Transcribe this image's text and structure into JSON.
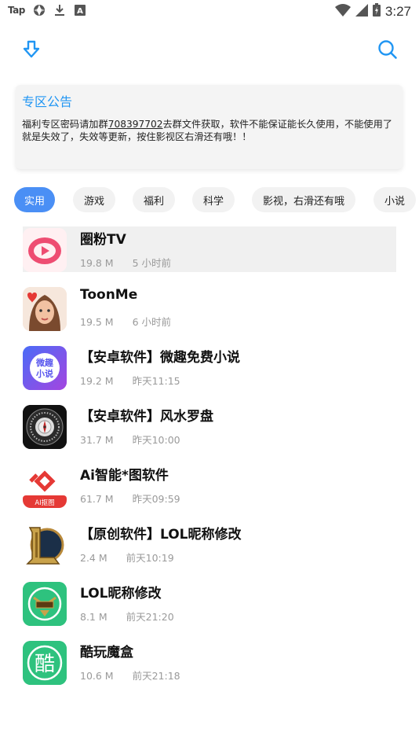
{
  "status_bar": {
    "left_text": "Tap",
    "time": "3:27",
    "icons": [
      "aperture-icon",
      "download-icon",
      "keyboard-icon",
      "wifi-icon",
      "signal-icon",
      "battery-icon"
    ]
  },
  "toolbar": {
    "download_icon": "download-arrow-icon",
    "search_icon": "search-icon",
    "accent_color": "#2196f3"
  },
  "notice": {
    "title": "专区公告",
    "body_prefix": "福利专区密码请加群",
    "qq_group": "708397702",
    "body_suffix": "去群文件获取，软件不能保证能长久使用，不能使用了就是失效了，失效等更新，按住影视区右滑还有哦！！"
  },
  "tabs": [
    {
      "label": "实用",
      "active": true
    },
    {
      "label": "游戏",
      "active": false
    },
    {
      "label": "福利",
      "active": false
    },
    {
      "label": "科学",
      "active": false
    },
    {
      "label": "影视，右滑还有哦",
      "active": false
    },
    {
      "label": "小说",
      "active": false
    }
  ],
  "apps": [
    {
      "name": "圈粉TV",
      "size": "19.8 M",
      "time": "5 小时前",
      "icon": "quanfen-tv-icon"
    },
    {
      "name": "ToonMe",
      "size": "19.5 M",
      "time": "6 小时前",
      "icon": "toonme-icon"
    },
    {
      "name": "【安卓软件】微趣免费小说",
      "size": "19.2 M",
      "time": "昨天11:15",
      "icon": "weiqu-novel-icon",
      "icon_text": "微趣小说"
    },
    {
      "name": "【安卓软件】风水罗盘",
      "size": "31.7 M",
      "time": "昨天10:00",
      "icon": "compass-icon"
    },
    {
      "name": "Ai智能*图软件",
      "size": "61.7 M",
      "time": "昨天09:59",
      "icon": "ai-cutout-icon",
      "icon_text": "AI抠图"
    },
    {
      "name": "【原创软件】LOL昵称修改",
      "size": "2.4 M",
      "time": "前天10:19",
      "icon": "lol-icon"
    },
    {
      "name": "LOL昵称修改",
      "size": "8.1 M",
      "time": "前天21:20",
      "icon": "lol-nickname-icon"
    },
    {
      "name": "酷玩魔盒",
      "size": "10.6 M",
      "time": "前天21:18",
      "icon": "kuwan-box-icon",
      "icon_text": "酷"
    }
  ]
}
